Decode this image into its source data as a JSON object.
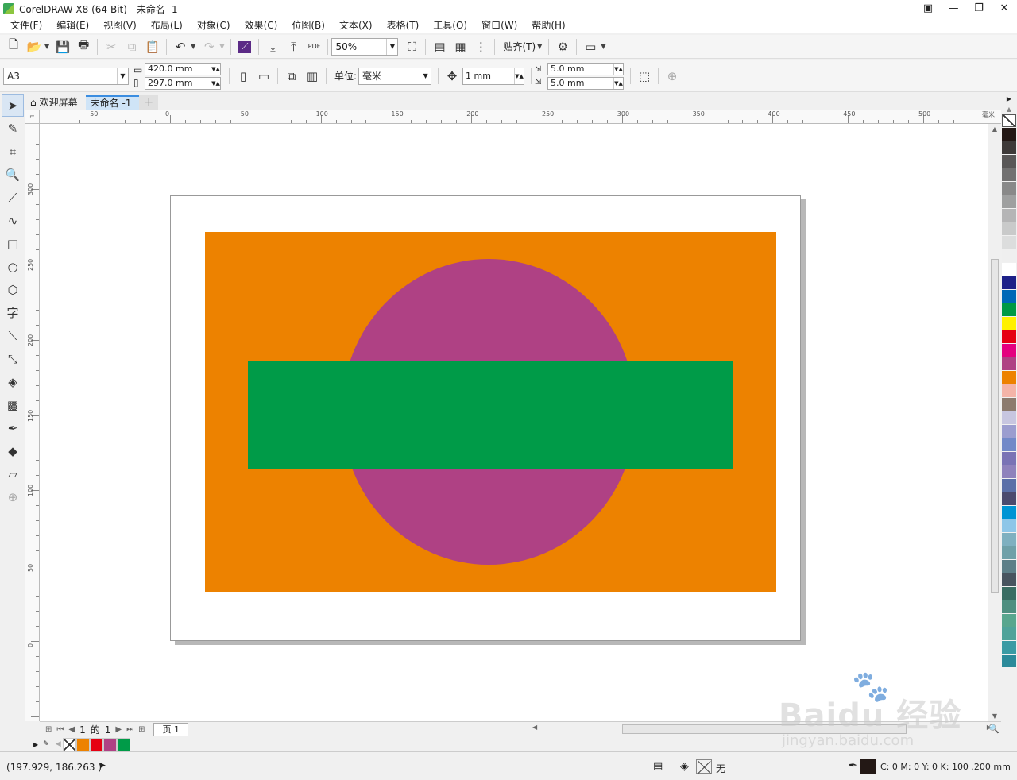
{
  "window": {
    "title": "CorelDRAW X8 (64-Bit) - 未命名 -1"
  },
  "menu": [
    "文件(F)",
    "编辑(E)",
    "视图(V)",
    "布局(L)",
    "对象(C)",
    "效果(C)",
    "位图(B)",
    "文本(X)",
    "表格(T)",
    "工具(O)",
    "窗口(W)",
    "帮助(H)"
  ],
  "toolbar": {
    "zoom": "50%",
    "snap_label": "贴齐(T)"
  },
  "propbar": {
    "page_size": "A3",
    "width": "420.0 mm",
    "height": "297.0 mm",
    "units_label": "单位:",
    "units": "毫米",
    "nudge": "1 mm",
    "dup_x": "5.0 mm",
    "dup_y": "5.0 mm"
  },
  "tabs": {
    "welcome": "欢迎屏幕",
    "document": "未命名 -1",
    "add": "+"
  },
  "ruler": {
    "h_labels": [
      "50",
      "0",
      "50",
      "100",
      "150",
      "200",
      "250",
      "300",
      "350",
      "400",
      "450",
      "500"
    ],
    "unit": "毫米",
    "v_labels": [
      "300",
      "250",
      "200",
      "150",
      "100",
      "50",
      "0"
    ]
  },
  "canvas": {
    "colors": {
      "orange": "#ED8200",
      "magenta": "#AF4184",
      "green": "#009B48"
    }
  },
  "pagenav": {
    "current": "1",
    "of_label": "的",
    "total": "1",
    "page_tab": "页 1"
  },
  "doc_palette": [
    "none",
    "#ED8200",
    "#E60012",
    "#AF4184",
    "#009B48"
  ],
  "palette": [
    "none",
    "#231815",
    "#3e3a39",
    "#595757",
    "#727171",
    "#898989",
    "#9fa0a0",
    "#b5b5b6",
    "#c9caca",
    "#dcdddd",
    "#efefef",
    "#ffffff",
    "#1d2088",
    "#0068b7",
    "#009944",
    "#fff100",
    "#e60012",
    "#e4007f",
    "#af4184",
    "#ed8200",
    "#f4b4a8",
    "#8c7b6e",
    "#c7c6e0",
    "#9b9dcf",
    "#7289c8",
    "#7a73b5",
    "#8f82bc",
    "#5a6fa8",
    "#4b4a6e",
    "#0094d4",
    "#8ec6e8",
    "#7fb0c0",
    "#6fa0a8",
    "#5d7f88",
    "#48545f",
    "#3a6d63",
    "#4e8f80",
    "#58a68e",
    "#4fa39a",
    "#3a9aa4",
    "#2c8a9a"
  ],
  "status": {
    "coords": "(197.929, 186.263 )",
    "fill_label": "无",
    "outline_info": "C: 0 M: 0 Y: 0 K: 100  .200 mm"
  },
  "watermark": {
    "logo": "Baidu 经验",
    "url": "jingyan.baidu.com"
  }
}
